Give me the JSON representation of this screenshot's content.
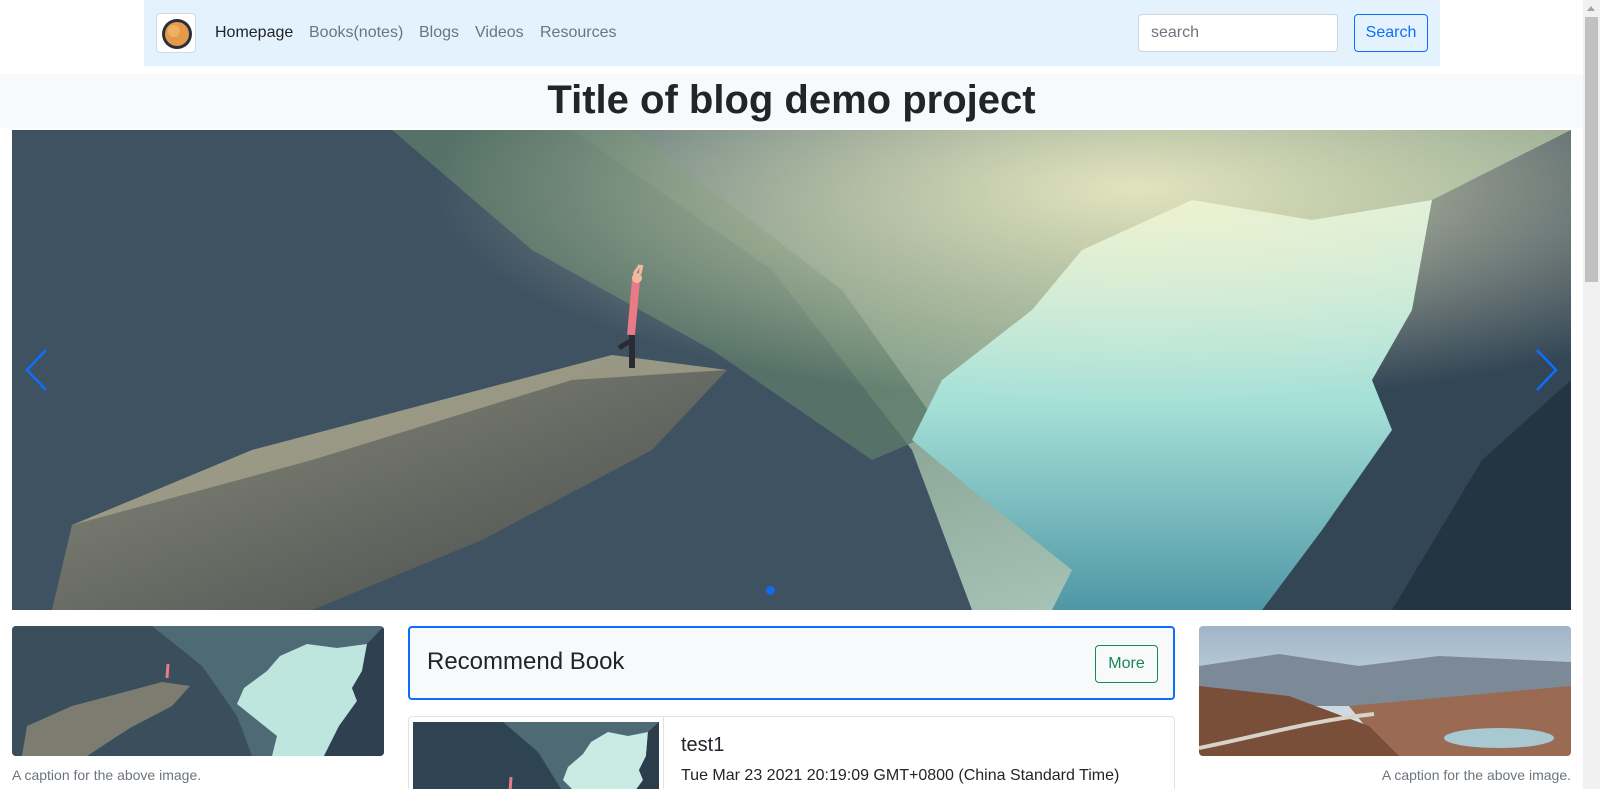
{
  "nav": {
    "logo_icon": "planet-logo-icon",
    "links": [
      {
        "label": "Homepage",
        "active": true
      },
      {
        "label": "Books(notes)",
        "active": false
      },
      {
        "label": "Blogs",
        "active": false
      },
      {
        "label": "Videos",
        "active": false
      },
      {
        "label": "Resources",
        "active": false
      }
    ],
    "search_placeholder": "search",
    "search_button": "Search"
  },
  "header": {
    "title": "Title of blog demo project"
  },
  "carousel": {
    "prev_icon": "chevron-left-icon",
    "next_icon": "chevron-right-icon",
    "active_slide": 1,
    "slide_count": 1
  },
  "left_figure": {
    "caption": "A caption for the above image."
  },
  "right_figure": {
    "caption": "A caption for the above image."
  },
  "recommend": {
    "title": "Recommend Book",
    "more_button": "More"
  },
  "book": {
    "title": "test1",
    "date": "Tue Mar 23 2021 20:19:09 GMT+0800 (China Standard Time)"
  },
  "colors": {
    "navbar_bg": "#e3f2fd",
    "primary": "#0d6efd",
    "success": "#198754",
    "muted": "#6c757d"
  }
}
